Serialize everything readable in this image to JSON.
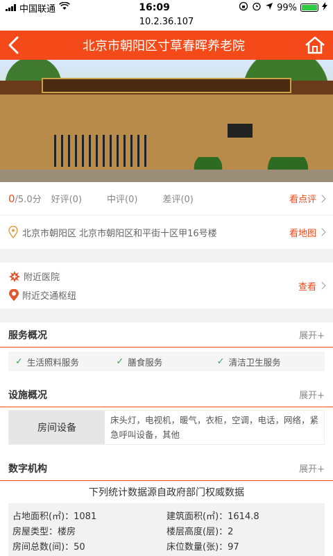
{
  "status_bar": {
    "carrier": "中国联通",
    "time": "16:09",
    "battery": "99%",
    "battery_level": 0.99
  },
  "url": "10.2.36.107",
  "header": {
    "title": "北京市朝阳区寸草春晖养老院"
  },
  "rating": {
    "score": "0",
    "score_max": "/5.0分",
    "good": "好评(0)",
    "medium": "中评(0)",
    "bad": "差评(0)",
    "more": "看点评"
  },
  "address": {
    "text": "北京市朝阳区 北京市朝阳区和平街十区甲16号楼",
    "more": "看地图"
  },
  "nearby": {
    "hospital": "附近医院",
    "transport": "附近交通枢纽",
    "more": "查看"
  },
  "services": {
    "title": "服务概况",
    "expand": "展开+",
    "tags": [
      "生活照料服务",
      "膳食服务",
      "清洁卫生服务"
    ]
  },
  "facilities": {
    "title": "设施概况",
    "expand": "展开+",
    "label": "房间设备",
    "value": "床头灯，电视机，暖气，衣柜，空调，电话，网络，紧急呼叫设备，其他"
  },
  "digital": {
    "title": "数字机构",
    "expand": "展开+",
    "note": "下列统计数据源自政府部门权威数据",
    "stats": [
      [
        "占地面积(㎡)：1081",
        "建筑面积(㎡)：1614.8"
      ],
      [
        "房屋类型：楼房",
        "楼层高度(层)：2"
      ],
      [
        "房间总数(间)：50",
        "床位数量(张)：97"
      ]
    ]
  }
}
